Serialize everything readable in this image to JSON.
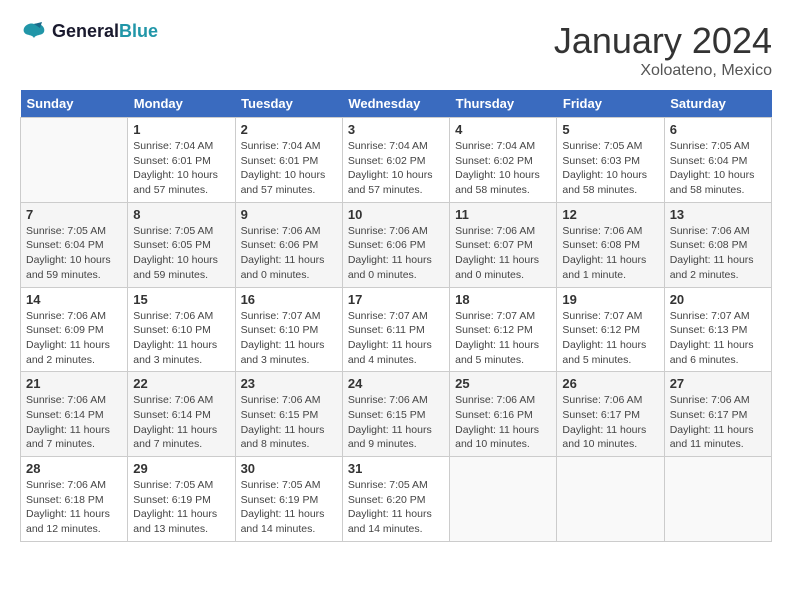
{
  "header": {
    "logo_line1": "General",
    "logo_line2": "Blue",
    "month_year": "January 2024",
    "location": "Xoloateno, Mexico"
  },
  "weekdays": [
    "Sunday",
    "Monday",
    "Tuesday",
    "Wednesday",
    "Thursday",
    "Friday",
    "Saturday"
  ],
  "weeks": [
    [
      {
        "num": "",
        "info": ""
      },
      {
        "num": "1",
        "info": "Sunrise: 7:04 AM\nSunset: 6:01 PM\nDaylight: 10 hours\nand 57 minutes."
      },
      {
        "num": "2",
        "info": "Sunrise: 7:04 AM\nSunset: 6:01 PM\nDaylight: 10 hours\nand 57 minutes."
      },
      {
        "num": "3",
        "info": "Sunrise: 7:04 AM\nSunset: 6:02 PM\nDaylight: 10 hours\nand 57 minutes."
      },
      {
        "num": "4",
        "info": "Sunrise: 7:04 AM\nSunset: 6:02 PM\nDaylight: 10 hours\nand 58 minutes."
      },
      {
        "num": "5",
        "info": "Sunrise: 7:05 AM\nSunset: 6:03 PM\nDaylight: 10 hours\nand 58 minutes."
      },
      {
        "num": "6",
        "info": "Sunrise: 7:05 AM\nSunset: 6:04 PM\nDaylight: 10 hours\nand 58 minutes."
      }
    ],
    [
      {
        "num": "7",
        "info": "Sunrise: 7:05 AM\nSunset: 6:04 PM\nDaylight: 10 hours\nand 59 minutes."
      },
      {
        "num": "8",
        "info": "Sunrise: 7:05 AM\nSunset: 6:05 PM\nDaylight: 10 hours\nand 59 minutes."
      },
      {
        "num": "9",
        "info": "Sunrise: 7:06 AM\nSunset: 6:06 PM\nDaylight: 11 hours\nand 0 minutes."
      },
      {
        "num": "10",
        "info": "Sunrise: 7:06 AM\nSunset: 6:06 PM\nDaylight: 11 hours\nand 0 minutes."
      },
      {
        "num": "11",
        "info": "Sunrise: 7:06 AM\nSunset: 6:07 PM\nDaylight: 11 hours\nand 0 minutes."
      },
      {
        "num": "12",
        "info": "Sunrise: 7:06 AM\nSunset: 6:08 PM\nDaylight: 11 hours\nand 1 minute."
      },
      {
        "num": "13",
        "info": "Sunrise: 7:06 AM\nSunset: 6:08 PM\nDaylight: 11 hours\nand 2 minutes."
      }
    ],
    [
      {
        "num": "14",
        "info": "Sunrise: 7:06 AM\nSunset: 6:09 PM\nDaylight: 11 hours\nand 2 minutes."
      },
      {
        "num": "15",
        "info": "Sunrise: 7:06 AM\nSunset: 6:10 PM\nDaylight: 11 hours\nand 3 minutes."
      },
      {
        "num": "16",
        "info": "Sunrise: 7:07 AM\nSunset: 6:10 PM\nDaylight: 11 hours\nand 3 minutes."
      },
      {
        "num": "17",
        "info": "Sunrise: 7:07 AM\nSunset: 6:11 PM\nDaylight: 11 hours\nand 4 minutes."
      },
      {
        "num": "18",
        "info": "Sunrise: 7:07 AM\nSunset: 6:12 PM\nDaylight: 11 hours\nand 5 minutes."
      },
      {
        "num": "19",
        "info": "Sunrise: 7:07 AM\nSunset: 6:12 PM\nDaylight: 11 hours\nand 5 minutes."
      },
      {
        "num": "20",
        "info": "Sunrise: 7:07 AM\nSunset: 6:13 PM\nDaylight: 11 hours\nand 6 minutes."
      }
    ],
    [
      {
        "num": "21",
        "info": "Sunrise: 7:06 AM\nSunset: 6:14 PM\nDaylight: 11 hours\nand 7 minutes."
      },
      {
        "num": "22",
        "info": "Sunrise: 7:06 AM\nSunset: 6:14 PM\nDaylight: 11 hours\nand 7 minutes."
      },
      {
        "num": "23",
        "info": "Sunrise: 7:06 AM\nSunset: 6:15 PM\nDaylight: 11 hours\nand 8 minutes."
      },
      {
        "num": "24",
        "info": "Sunrise: 7:06 AM\nSunset: 6:15 PM\nDaylight: 11 hours\nand 9 minutes."
      },
      {
        "num": "25",
        "info": "Sunrise: 7:06 AM\nSunset: 6:16 PM\nDaylight: 11 hours\nand 10 minutes."
      },
      {
        "num": "26",
        "info": "Sunrise: 7:06 AM\nSunset: 6:17 PM\nDaylight: 11 hours\nand 10 minutes."
      },
      {
        "num": "27",
        "info": "Sunrise: 7:06 AM\nSunset: 6:17 PM\nDaylight: 11 hours\nand 11 minutes."
      }
    ],
    [
      {
        "num": "28",
        "info": "Sunrise: 7:06 AM\nSunset: 6:18 PM\nDaylight: 11 hours\nand 12 minutes."
      },
      {
        "num": "29",
        "info": "Sunrise: 7:05 AM\nSunset: 6:19 PM\nDaylight: 11 hours\nand 13 minutes."
      },
      {
        "num": "30",
        "info": "Sunrise: 7:05 AM\nSunset: 6:19 PM\nDaylight: 11 hours\nand 14 minutes."
      },
      {
        "num": "31",
        "info": "Sunrise: 7:05 AM\nSunset: 6:20 PM\nDaylight: 11 hours\nand 14 minutes."
      },
      {
        "num": "",
        "info": ""
      },
      {
        "num": "",
        "info": ""
      },
      {
        "num": "",
        "info": ""
      }
    ]
  ]
}
